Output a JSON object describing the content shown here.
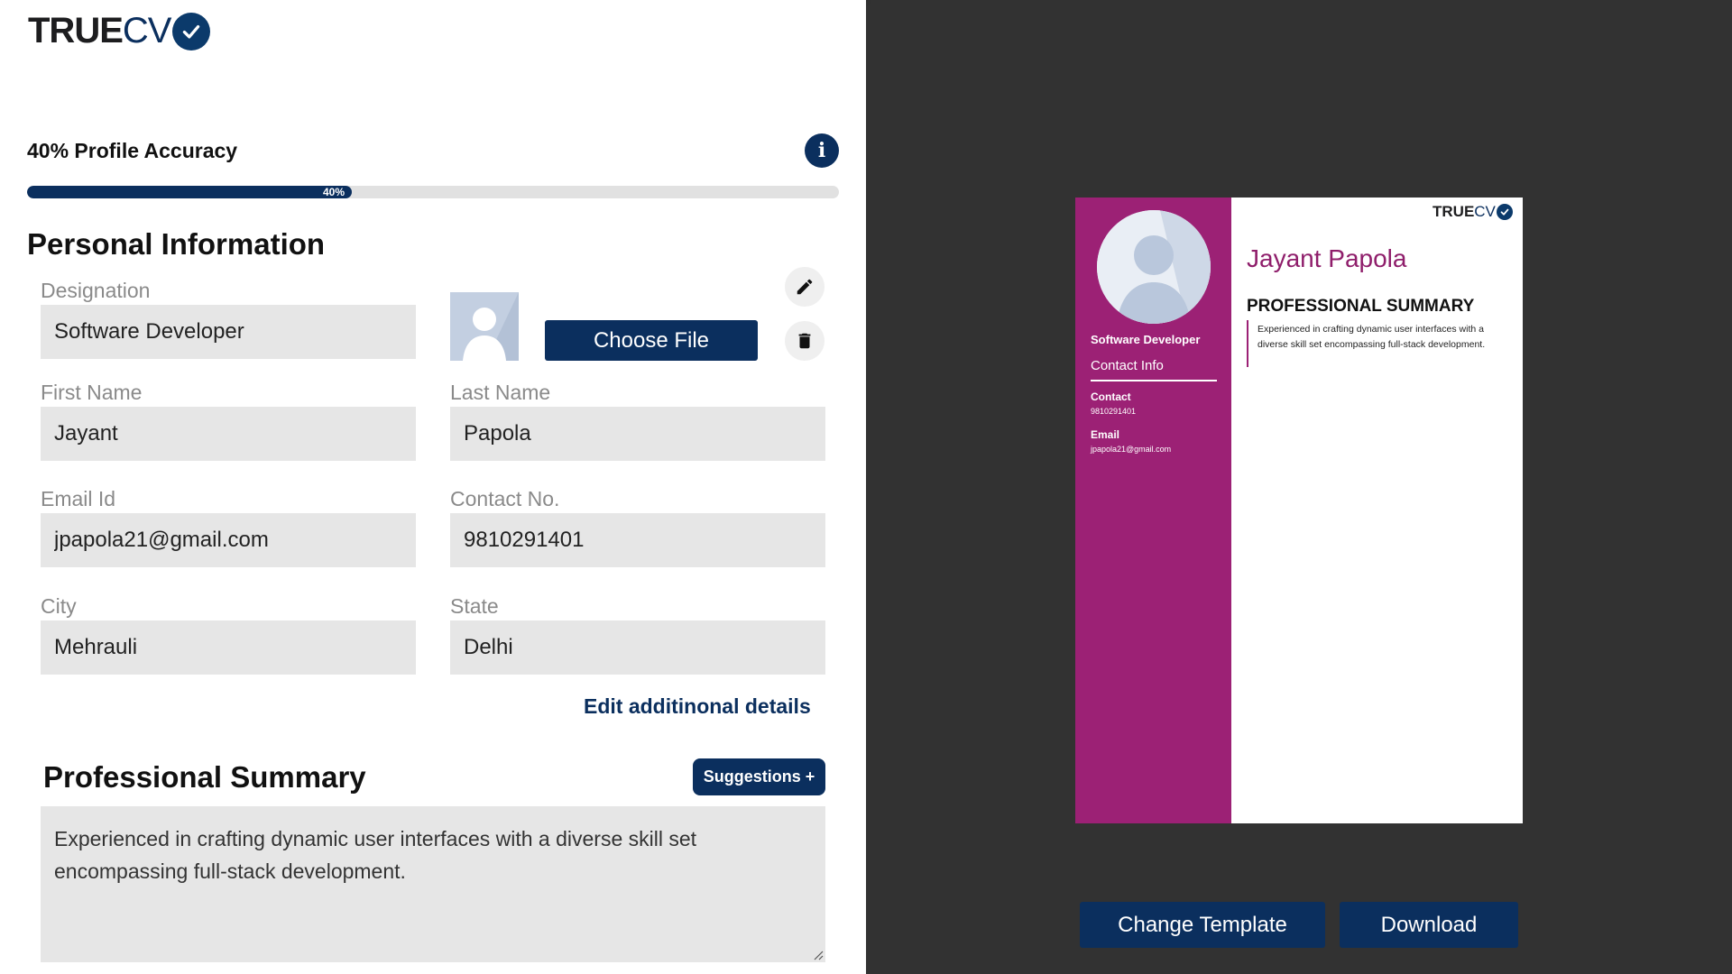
{
  "brand": {
    "true_text": "TRUE",
    "cv_text": "CV"
  },
  "profile": {
    "accuracy_label": "40% Profile Accuracy",
    "progress_percent": 40,
    "progress_text": "40%"
  },
  "personal": {
    "section_title": "Personal Information",
    "designation_label": "Designation",
    "designation_value": "Software Developer",
    "choose_file_label": "Choose File",
    "first_name_label": "First Name",
    "first_name_value": "Jayant",
    "last_name_label": "Last Name",
    "last_name_value": "Papola",
    "email_label": "Email Id",
    "email_value": "jpapola21@gmail.com",
    "contact_label": "Contact No.",
    "contact_value": "9810291401",
    "city_label": "City",
    "city_value": "Mehrauli",
    "state_label": "State",
    "state_value": "Delhi",
    "edit_link": "Edit additinonal details"
  },
  "summary": {
    "section_title": "Professional Summary",
    "suggestions_label": "Suggestions +",
    "text": "Experienced in crafting dynamic user interfaces with a diverse skill set encompassing full-stack development."
  },
  "preview": {
    "designation": "Software Developer",
    "contact_info_heading": "Contact Info",
    "contact_heading": "Contact",
    "contact_value": "9810291401",
    "email_heading": "Email",
    "email_value": "jpapola21@gmail.com",
    "name": "Jayant Papola",
    "summary_heading": "PROFESSIONAL SUMMARY",
    "summary_text": "Experienced in crafting dynamic user interfaces with a diverse skill set encompassing full-stack development."
  },
  "actions": {
    "change_template_label": "Change Template",
    "download_label": "Download"
  },
  "icons": {
    "info": "info-icon",
    "edit": "pencil-icon",
    "delete": "trash-icon",
    "check": "check-icon"
  },
  "colors": {
    "primary": "#0b2f5e",
    "resume_sidebar": "#9c2175",
    "resume_name": "#8f1e6b",
    "preview_background": "#323232",
    "input_background": "#e6e6e6"
  }
}
